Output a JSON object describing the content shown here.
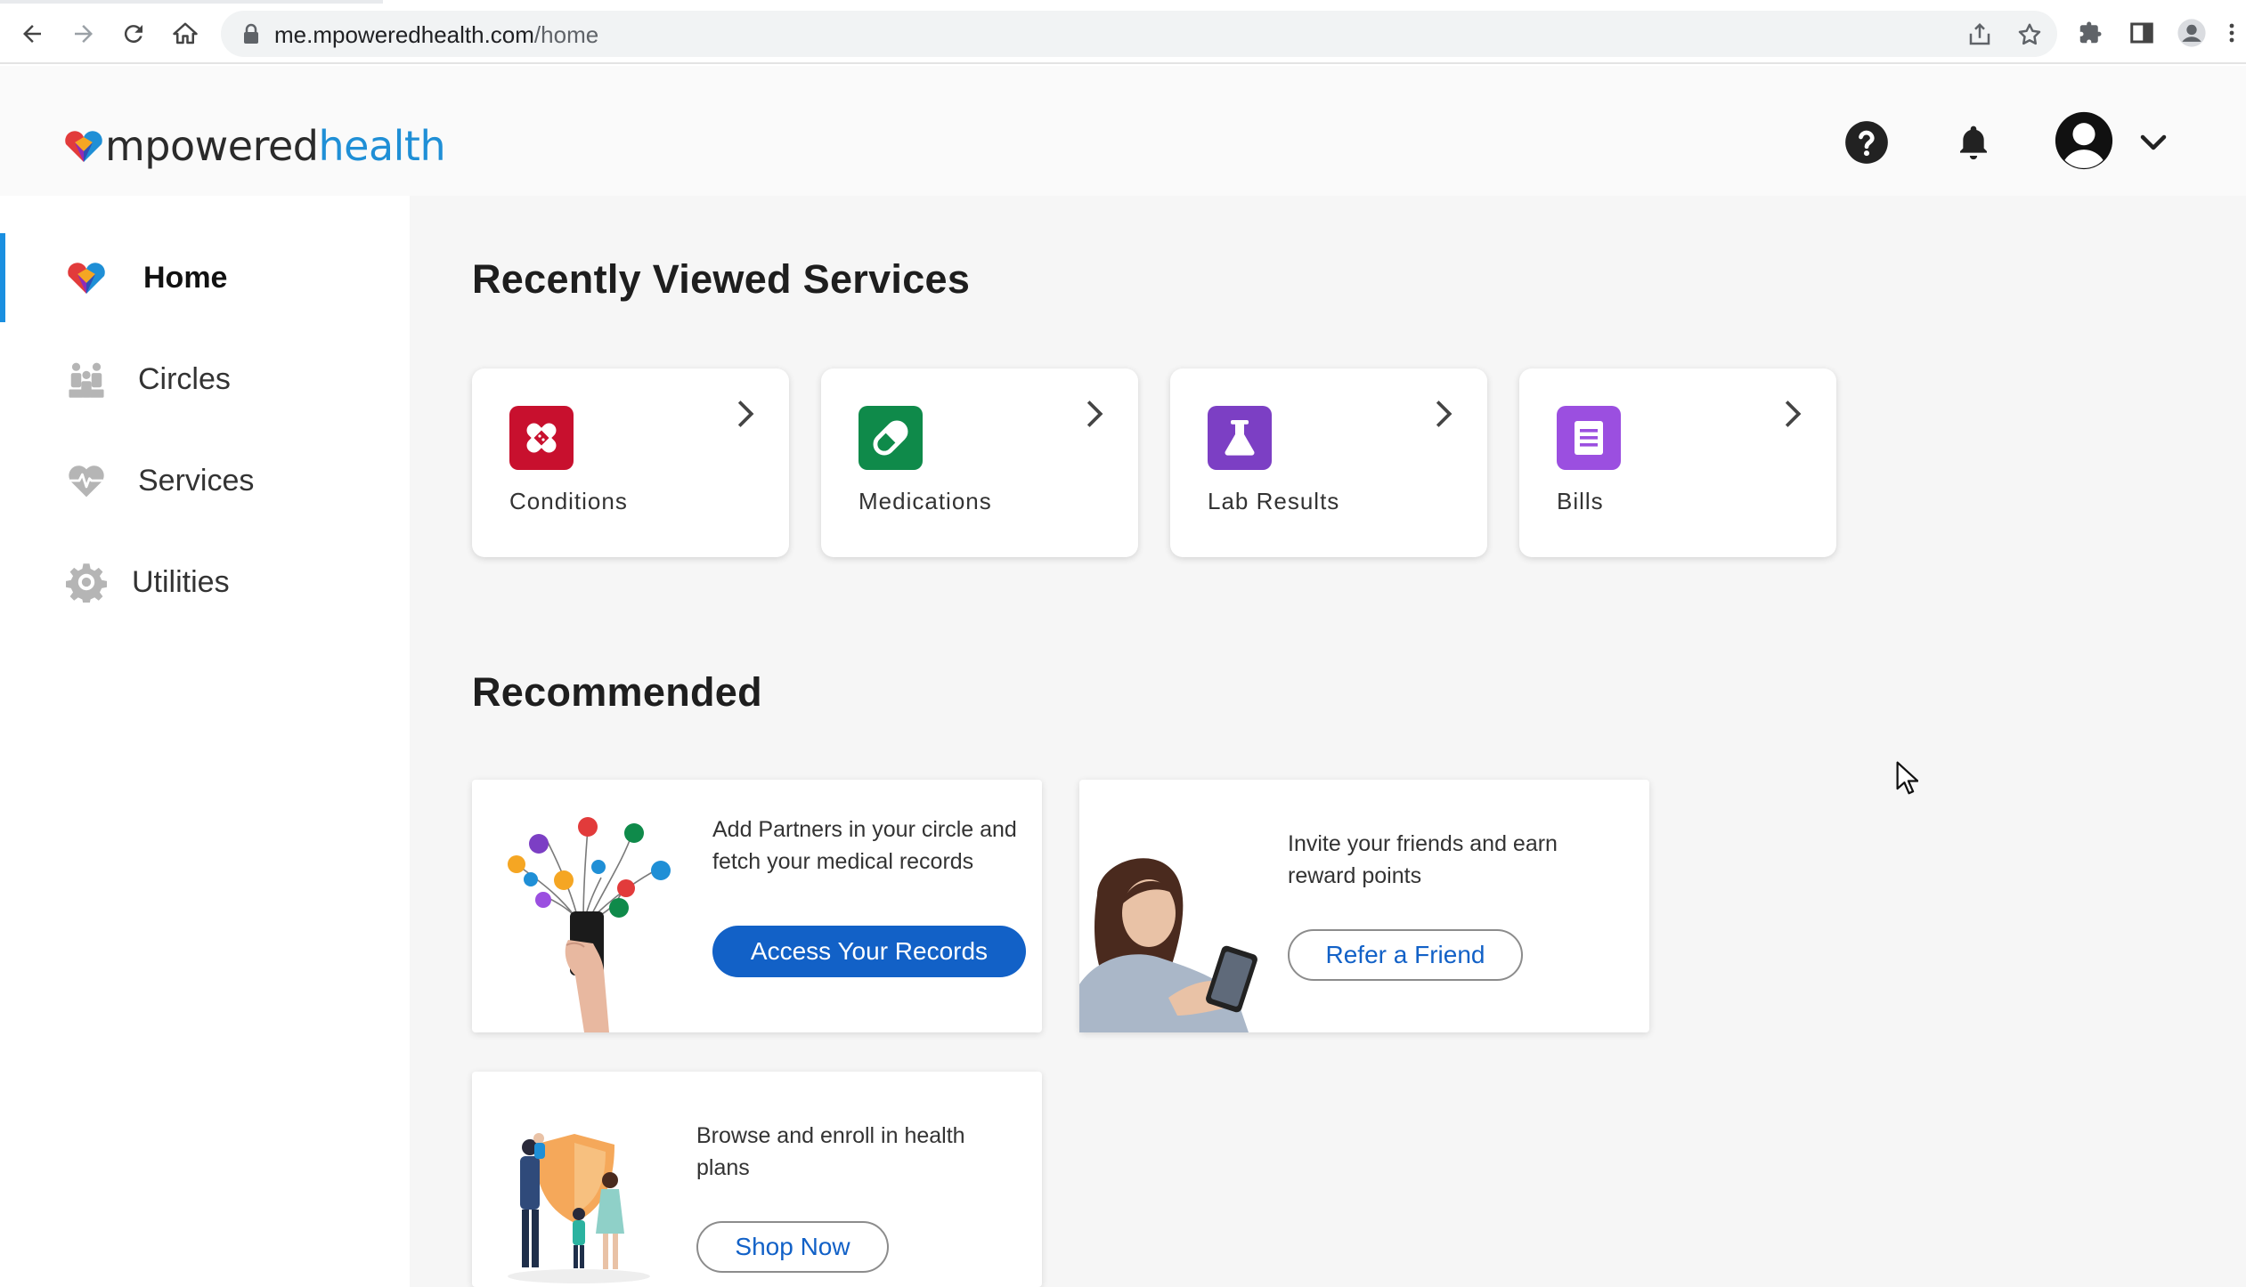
{
  "browser": {
    "url_host": "me.mpoweredhealth.com",
    "url_path": "/home"
  },
  "brand": {
    "part1": "mpowered",
    "part2": "health",
    "accent_color": "#1f8fd6"
  },
  "header": {
    "icons": [
      "help-icon",
      "bell-icon",
      "avatar-icon",
      "chevron-down-icon"
    ]
  },
  "sidebar": {
    "items": [
      {
        "label": "Home",
        "icon": "home-logo-icon",
        "active": true
      },
      {
        "label": "Circles",
        "icon": "circles-icon",
        "active": false
      },
      {
        "label": "Services",
        "icon": "services-heart-icon",
        "active": false
      },
      {
        "label": "Utilities",
        "icon": "gear-icon",
        "active": false
      }
    ]
  },
  "recent": {
    "title": "Recently Viewed Services",
    "cards": [
      {
        "label": "Conditions",
        "icon": "bandage-icon",
        "color": "#c8102e"
      },
      {
        "label": "Medications",
        "icon": "pill-icon",
        "color": "#0f8a4a"
      },
      {
        "label": "Lab Results",
        "icon": "flask-icon",
        "color": "#7c3fc4"
      },
      {
        "label": "Bills",
        "icon": "bill-icon",
        "color": "#9b4fe0"
      }
    ]
  },
  "recommended": {
    "title": "Recommended",
    "cards": [
      {
        "text": "Add Partners in your circle and fetch your medical records",
        "button": "Access Your Records"
      },
      {
        "text": "Invite your friends and earn reward points",
        "button": "Refer a Friend"
      },
      {
        "text": "Browse and enroll in health plans",
        "button": "Shop Now"
      }
    ]
  }
}
